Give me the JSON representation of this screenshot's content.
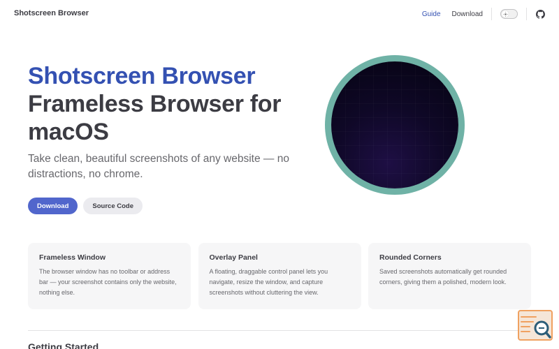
{
  "nav": {
    "title": "Shotscreen Browser",
    "links": [
      "Guide",
      "Download"
    ],
    "appearance_toggle_icon": "sun-icon",
    "social_icon": "github-icon"
  },
  "hero": {
    "name": "Shotscreen Browser",
    "text": "Frameless Browser for macOS",
    "tagline": "Take clean, beautiful screenshots of any website — no distractions, no chrome.",
    "actions": {
      "primary": "Download",
      "secondary": "Source Code"
    }
  },
  "features": [
    {
      "title": "Frameless Window",
      "details": "The browser window has no toolbar or address bar — your screenshot contains only the website, nothing else."
    },
    {
      "title": "Overlay Panel",
      "details": "A floating, draggable control panel lets you navigate, resize the window, and capture screenshots without cluttering the view."
    },
    {
      "title": "Rounded Corners",
      "details": "Saved screenshots automatically get rounded corners, giving them a polished, modern look."
    }
  ],
  "section": {
    "title": "Getting Started"
  },
  "colors": {
    "brand": "#3451b2",
    "brand_button": "#5166cc",
    "image_ring": "#6fb2a6",
    "widget_accent": "#f0a160",
    "widget_icon": "#2b5d78"
  }
}
